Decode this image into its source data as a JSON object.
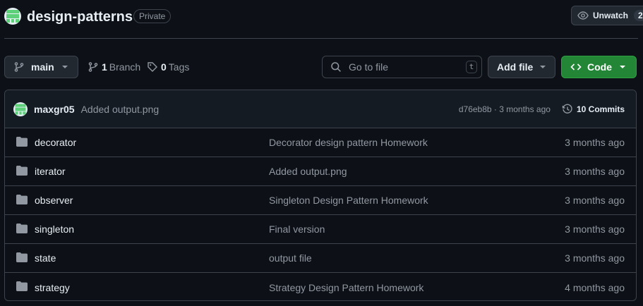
{
  "repo": {
    "name": "design-patterns",
    "visibility": "Private"
  },
  "watch": {
    "label": "Unwatch",
    "count": "2"
  },
  "toolbar": {
    "branch": "main",
    "branch_count": "1",
    "branch_label": "Branch",
    "tag_count": "0",
    "tag_label": "Tags",
    "search_placeholder": "Go to file",
    "search_shortcut": "t",
    "add_file_label": "Add file",
    "code_label": "Code"
  },
  "latest_commit": {
    "author": "maxgr05",
    "message": "Added output.png",
    "meta": "d76eb8b · 3 months ago",
    "commits_label": "10 Commits"
  },
  "files": [
    {
      "name": "decorator",
      "message": "Decorator design pattern Homework",
      "date": "3 months ago"
    },
    {
      "name": "iterator",
      "message": "Added output.png",
      "date": "3 months ago"
    },
    {
      "name": "observer",
      "message": "Singleton Design Pattern Homework",
      "date": "3 months ago"
    },
    {
      "name": "singleton",
      "message": "Final version",
      "date": "3 months ago"
    },
    {
      "name": "state",
      "message": "output file",
      "date": "3 months ago"
    },
    {
      "name": "strategy",
      "message": "Strategy Design Pattern Homework",
      "date": "4 months ago"
    }
  ],
  "colors": {
    "background": "#0d1117",
    "primary_button": "#238636",
    "folder_icon": "#9198a1",
    "avatar": "#5cd17a"
  },
  "icons": {
    "avatar": "identicon",
    "watch": "eye-icon",
    "branch": "git-branch-icon",
    "tag": "tag-icon",
    "search": "search-icon",
    "code": "code-icon",
    "history": "history-icon",
    "folder": "folder-icon"
  }
}
